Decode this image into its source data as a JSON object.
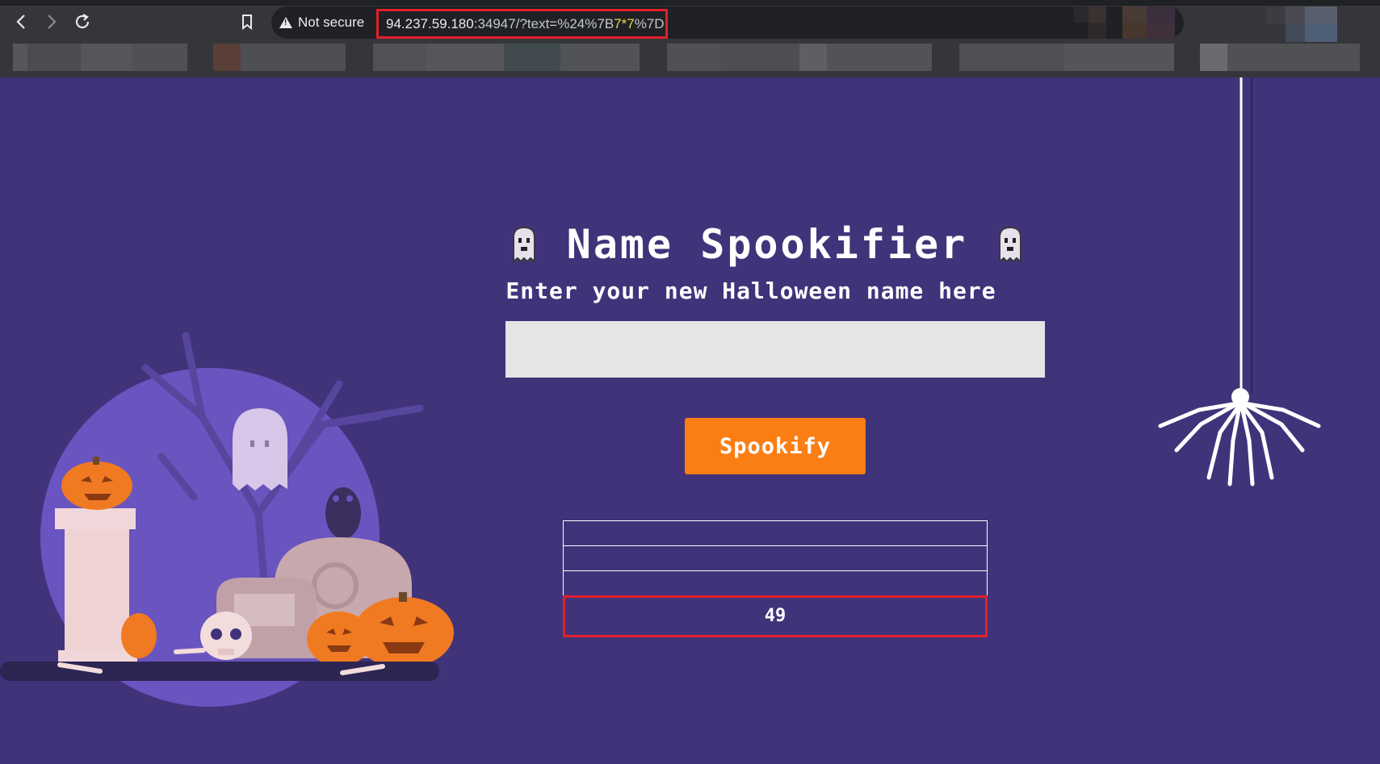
{
  "browser": {
    "security_label": "Not secure",
    "url_host": "94.237.59.180",
    "url_rest_a": ":34947/?text=%24%7B",
    "url_highlight": "7*7",
    "url_rest_b": "%7D",
    "icons": [
      "back-arrow-icon",
      "forward-arrow-icon",
      "reload-icon",
      "bookmark-icon",
      "warning-icon"
    ]
  },
  "page": {
    "title": "Name Spookifier",
    "subtitle": "Enter your new Halloween name here",
    "input": {
      "value": "",
      "placeholder": ""
    },
    "button_label": "Spookify",
    "results": [
      "",
      "",
      "",
      "49"
    ]
  },
  "colors": {
    "background": "#41337a",
    "button": "#fb7e14",
    "input": "#e5e5e5",
    "highlight_border": "#e2202b",
    "url_highlight": "#e8d44d"
  }
}
